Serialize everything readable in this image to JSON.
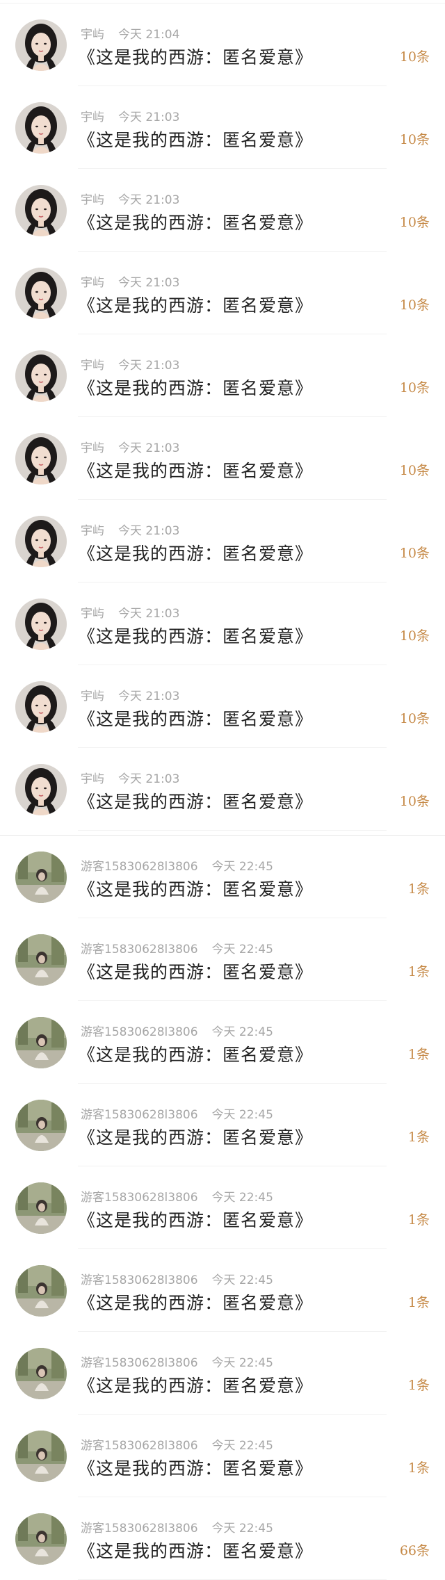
{
  "colors": {
    "meta_text": "#a6a6a6",
    "message_text": "#222222",
    "count_text": "#c68a48"
  },
  "list_a": [
    {
      "name": "宇屿",
      "time": "今天 21:04",
      "message": "《这是我的西游：匿名爱意》",
      "count": "10条",
      "avatar": "portrait-woman-icon"
    },
    {
      "name": "宇屿",
      "time": "今天 21:03",
      "message": "《这是我的西游：匿名爱意》",
      "count": "10条",
      "avatar": "portrait-woman-icon"
    },
    {
      "name": "宇屿",
      "time": "今天 21:03",
      "message": "《这是我的西游：匿名爱意》",
      "count": "10条",
      "avatar": "portrait-woman-icon"
    },
    {
      "name": "宇屿",
      "time": "今天 21:03",
      "message": "《这是我的西游：匿名爱意》",
      "count": "10条",
      "avatar": "portrait-woman-icon"
    },
    {
      "name": "宇屿",
      "time": "今天 21:03",
      "message": "《这是我的西游：匿名爱意》",
      "count": "10条",
      "avatar": "portrait-woman-icon"
    },
    {
      "name": "宇屿",
      "time": "今天 21:03",
      "message": "《这是我的西游：匿名爱意》",
      "count": "10条",
      "avatar": "portrait-woman-icon"
    },
    {
      "name": "宇屿",
      "time": "今天 21:03",
      "message": "《这是我的西游：匿名爱意》",
      "count": "10条",
      "avatar": "portrait-woman-icon"
    },
    {
      "name": "宇屿",
      "time": "今天 21:03",
      "message": "《这是我的西游：匿名爱意》",
      "count": "10条",
      "avatar": "portrait-woman-icon"
    },
    {
      "name": "宇屿",
      "time": "今天 21:03",
      "message": "《这是我的西游：匿名爱意》",
      "count": "10条",
      "avatar": "portrait-woman-icon"
    },
    {
      "name": "宇屿",
      "time": "今天 21:03",
      "message": "《这是我的西游：匿名爱意》",
      "count": "10条",
      "avatar": "portrait-woman-icon"
    }
  ],
  "list_b": [
    {
      "name": "游客15830628l3806",
      "time": "今天 22:45",
      "message": "《这是我的西游：匿名爱意》",
      "count": "1条",
      "avatar": "outdoor-photo-icon"
    },
    {
      "name": "游客15830628l3806",
      "time": "今天 22:45",
      "message": "《这是我的西游：匿名爱意》",
      "count": "1条",
      "avatar": "outdoor-photo-icon"
    },
    {
      "name": "游客15830628l3806",
      "time": "今天 22:45",
      "message": "《这是我的西游：匿名爱意》",
      "count": "1条",
      "avatar": "outdoor-photo-icon"
    },
    {
      "name": "游客15830628l3806",
      "time": "今天 22:45",
      "message": "《这是我的西游：匿名爱意》",
      "count": "1条",
      "avatar": "outdoor-photo-icon"
    },
    {
      "name": "游客15830628l3806",
      "time": "今天 22:45",
      "message": "《这是我的西游：匿名爱意》",
      "count": "1条",
      "avatar": "outdoor-photo-icon"
    },
    {
      "name": "游客15830628l3806",
      "time": "今天 22:45",
      "message": "《这是我的西游：匿名爱意》",
      "count": "1条",
      "avatar": "outdoor-photo-icon"
    },
    {
      "name": "游客15830628l3806",
      "time": "今天 22:45",
      "message": "《这是我的西游：匿名爱意》",
      "count": "1条",
      "avatar": "outdoor-photo-icon"
    },
    {
      "name": "游客15830628l3806",
      "time": "今天 22:45",
      "message": "《这是我的西游：匿名爱意》",
      "count": "1条",
      "avatar": "outdoor-photo-icon"
    },
    {
      "name": "游客15830628l3806",
      "time": "今天 22:45",
      "message": "《这是我的西游：匿名爱意》",
      "count": "66条",
      "avatar": "outdoor-photo-icon"
    }
  ]
}
